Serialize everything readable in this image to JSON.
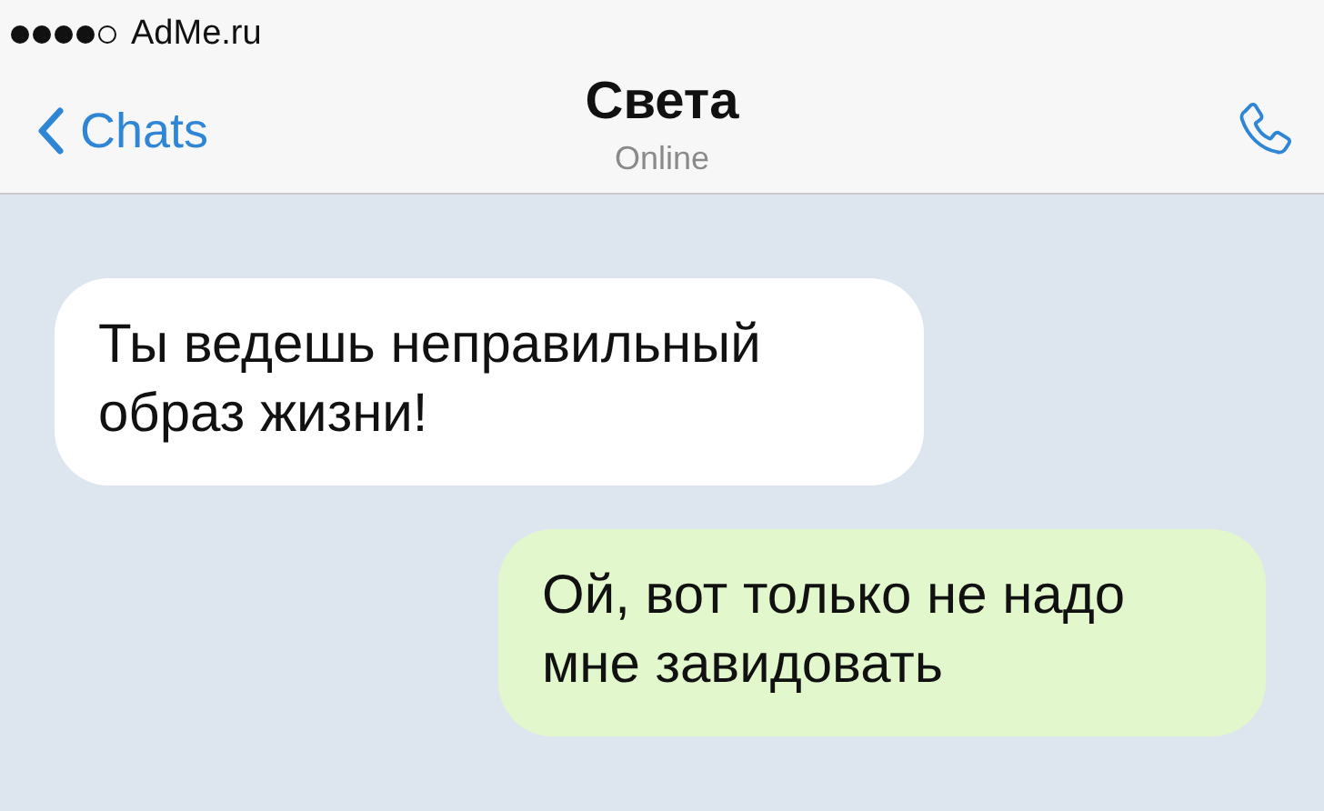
{
  "status_bar": {
    "signal_bars": [
      {
        "on": true
      },
      {
        "on": true
      },
      {
        "on": true
      },
      {
        "on": true
      },
      {
        "on": false
      }
    ],
    "carrier": "AdMe.ru"
  },
  "nav_bar": {
    "back": "Chats",
    "title": "Света",
    "subtitle": "Online"
  },
  "messages": [
    {
      "kind": "incoming",
      "text": "Ты ведешь неправильный образ жизни!"
    },
    {
      "kind": "outgoing",
      "text": "Ой, вот только не надо мне завидовать"
    }
  ]
}
